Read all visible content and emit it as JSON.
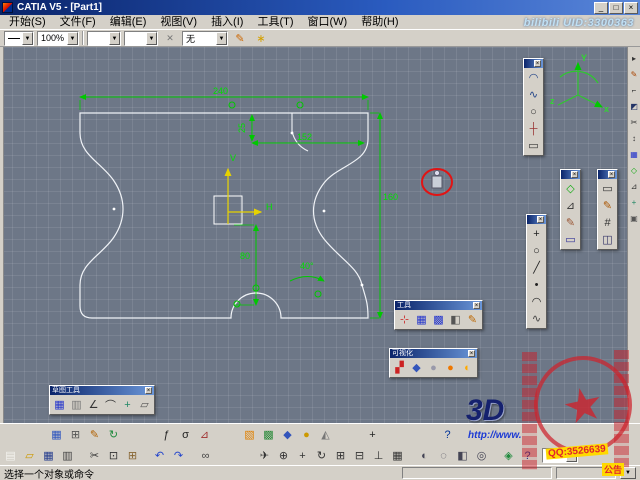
{
  "window": {
    "title": "CATIA V5 - [Part1]",
    "controls": [
      {
        "name": "minimize-button",
        "glyph": "_"
      },
      {
        "name": "maximize-button",
        "glyph": "□"
      },
      {
        "name": "close-button",
        "glyph": "×"
      }
    ]
  },
  "menu": {
    "items": [
      {
        "name": "menu-start",
        "label": "开始(S)"
      },
      {
        "name": "menu-file",
        "label": "文件(F)"
      },
      {
        "name": "menu-edit",
        "label": "编辑(E)"
      },
      {
        "name": "menu-view",
        "label": "视图(V)"
      },
      {
        "name": "menu-insert",
        "label": "插入(I)"
      },
      {
        "name": "menu-tools",
        "label": "工具(T)"
      },
      {
        "name": "menu-window",
        "label": "窗口(W)"
      },
      {
        "name": "menu-help",
        "label": "帮助(H)"
      }
    ]
  },
  "toolbar": {
    "zoom": "100%",
    "combo3": "",
    "combo4": "",
    "clear_glyph": "✕",
    "style_none": "无",
    "brush_glyph": "✎",
    "wand_glyph": "∗"
  },
  "viewport": {
    "dims": {
      "width": "240",
      "height": "160",
      "middle": "80",
      "step": "25",
      "upper": "152",
      "angle": "40°"
    },
    "labels": {
      "h": "H",
      "v": "V"
    },
    "compass": {
      "x": "x",
      "y": "Y",
      "z": "z"
    }
  },
  "palettes": {
    "a": {
      "icons": [
        {
          "name": "arc-icon",
          "glyph": "◠",
          "color": "#224488"
        },
        {
          "name": "spline-icon",
          "glyph": "∿",
          "color": "#224488"
        },
        {
          "name": "circle-tool-icon",
          "glyph": "○",
          "color": "#333333"
        },
        {
          "name": "axis-icon",
          "glyph": "┼",
          "color": "#993333"
        },
        {
          "name": "rect-tool-icon",
          "glyph": "▭",
          "color": "#333333"
        }
      ]
    },
    "b": {
      "icons": [
        {
          "name": "constraint-icon",
          "glyph": "◇",
          "color": "#11aa11"
        },
        {
          "name": "measure-icon",
          "glyph": "⊿",
          "color": "#333333"
        },
        {
          "name": "sketch-edit-icon",
          "glyph": "✎",
          "color": "#995533"
        },
        {
          "name": "frame-icon",
          "glyph": "▭",
          "color": "#333399"
        }
      ]
    },
    "c": {
      "icons": [
        {
          "name": "move-icon",
          "glyph": "+",
          "color": "#222222"
        },
        {
          "name": "circle-icon",
          "glyph": "○",
          "color": "#222222"
        },
        {
          "name": "line-icon",
          "glyph": "╱",
          "color": "#222222"
        },
        {
          "name": "point-icon",
          "glyph": "•",
          "color": "#222222"
        },
        {
          "name": "arc2-icon",
          "glyph": "◠",
          "color": "#222222"
        },
        {
          "name": "curve-icon",
          "glyph": "∿",
          "color": "#444444"
        }
      ]
    },
    "d": {
      "icons": [
        {
          "name": "plane-icon",
          "glyph": "▭",
          "color": "#333333"
        },
        {
          "name": "pencil-icon",
          "glyph": "✎",
          "color": "#aa5500"
        },
        {
          "name": "hatch-icon",
          "glyph": "#",
          "color": "#333333"
        },
        {
          "name": "view-icon",
          "glyph": "◫",
          "color": "#333366"
        }
      ]
    },
    "tools": {
      "title": "工具",
      "icons": [
        {
          "name": "axis-system-icon",
          "glyph": "⊹",
          "color": "#cc3333"
        },
        {
          "name": "grid-icon",
          "glyph": "▦",
          "color": "#2233cc"
        },
        {
          "name": "grid-dots-icon",
          "glyph": "▩",
          "color": "#2233cc"
        },
        {
          "name": "shade-half-icon",
          "glyph": "◧",
          "color": "#555555"
        },
        {
          "name": "edit-icon",
          "glyph": "✎",
          "color": "#bb6600"
        }
      ]
    },
    "viz": {
      "title": "可视化",
      "icons": [
        {
          "name": "paint-icon",
          "glyph": "▞",
          "color": "#cc2222"
        },
        {
          "name": "cube-icon",
          "glyph": "◆",
          "color": "#3355bb"
        },
        {
          "name": "gray-sphere-icon",
          "glyph": "●",
          "color": "#9999aa"
        },
        {
          "name": "orange-sphere-icon",
          "glyph": "●",
          "color": "#ee7700"
        },
        {
          "name": "halfshade-icon",
          "glyph": "◐",
          "color": "#ffaa00"
        }
      ]
    },
    "sketch": {
      "title": "草图工具",
      "icons": [
        {
          "name": "snap-grid-icon",
          "glyph": "▦",
          "color": "#2233cc"
        },
        {
          "name": "snap-point-icon",
          "glyph": "▥",
          "color": "#777777"
        },
        {
          "name": "angle-icon",
          "glyph": "∠",
          "color": "#333333"
        },
        {
          "name": "tangent-arc-icon",
          "glyph": "⌒",
          "color": "#333333"
        },
        {
          "name": "construction-icon",
          "glyph": "+",
          "color": "#228866"
        },
        {
          "name": "profile-icon",
          "glyph": "▱",
          "color": "#555555"
        }
      ]
    }
  },
  "rightbar": {
    "icons": [
      {
        "name": "select-icon",
        "glyph": "▸",
        "color": "#333333"
      },
      {
        "name": "pen-icon",
        "glyph": "✎",
        "color": "#aa4400"
      },
      {
        "name": "corner-icon",
        "glyph": "⌐",
        "color": "#333333"
      },
      {
        "name": "shade-icon",
        "glyph": "◩",
        "color": "#223366"
      },
      {
        "name": "trim-icon",
        "glyph": "✂",
        "color": "#333333"
      },
      {
        "name": "stretch-icon",
        "glyph": "↕",
        "color": "#333333"
      },
      {
        "name": "grid2-icon",
        "glyph": "▦",
        "color": "#2233cc"
      },
      {
        "name": "constraint2-icon",
        "glyph": "◇",
        "color": "#11aa11"
      },
      {
        "name": "triangle-icon",
        "glyph": "⊿",
        "color": "#333333"
      },
      {
        "name": "add-icon",
        "glyph": "+",
        "color": "#228866"
      },
      {
        "name": "box-icon",
        "glyph": "▣",
        "color": "#555555"
      }
    ]
  },
  "dock": {
    "row1": [
      {
        "name": "dock-grid-icon",
        "glyph": "▦",
        "color": "#2a52be",
        "ml": 46
      },
      {
        "name": "dock-table-icon",
        "glyph": "⊞",
        "color": "#555555"
      },
      {
        "name": "dock-pencil-icon",
        "glyph": "✎",
        "color": "#b06000"
      },
      {
        "name": "dock-update-icon",
        "glyph": "↻",
        "color": "#1f8a3d"
      },
      {
        "name": "dock-fx-icon",
        "glyph": "ƒ",
        "color": "#222222",
        "ml": 34
      },
      {
        "name": "dock-sigma-icon",
        "glyph": "σ",
        "color": "#222222"
      },
      {
        "name": "dock-measure-icon",
        "glyph": "⊿",
        "color": "#a03030"
      },
      {
        "name": "dock-orange-box-icon",
        "glyph": "▧",
        "color": "#e08000",
        "ml": 26
      },
      {
        "name": "dock-green-box-icon",
        "glyph": "▩",
        "color": "#2a8a3a"
      },
      {
        "name": "dock-diamond-icon",
        "glyph": "◆",
        "color": "#3355bb"
      },
      {
        "name": "dock-sphere-icon",
        "glyph": "●",
        "color": "#cc9900"
      },
      {
        "name": "dock-prism-icon",
        "glyph": "◭",
        "color": "#777777"
      },
      {
        "name": "dock-plus-icon",
        "glyph": "+",
        "color": "#222222",
        "ml": 28
      },
      {
        "name": "dock-help-icon",
        "glyph": "?",
        "color": "#003399",
        "ml": 56
      }
    ],
    "row2": [
      {
        "name": "new-icon",
        "glyph": "▤",
        "color": "#f5f5f0"
      },
      {
        "name": "open-icon",
        "glyph": "▱",
        "color": "#cc9900"
      },
      {
        "name": "save-icon",
        "glyph": "▦",
        "color": "#223a8c"
      },
      {
        "name": "print-icon",
        "glyph": "▥",
        "color": "#444444"
      },
      {
        "name": "cut-icon",
        "glyph": "✂",
        "color": "#333333",
        "ml": 8
      },
      {
        "name": "copy-icon",
        "glyph": "⊡",
        "color": "#333333"
      },
      {
        "name": "paste-icon",
        "glyph": "⊞",
        "color": "#886633"
      },
      {
        "name": "undo-icon",
        "glyph": "↶",
        "color": "#2244cc",
        "ml": 8
      },
      {
        "name": "redo-icon",
        "glyph": "↷",
        "color": "#2244cc"
      },
      {
        "name": "link-icon",
        "glyph": "∞",
        "color": "#444444",
        "ml": 8
      },
      {
        "name": "fly-icon",
        "glyph": "✈",
        "color": "#333333",
        "ml": 40
      },
      {
        "name": "fit-all-icon",
        "glyph": "⊕",
        "color": "#333333"
      },
      {
        "name": "pan-icon",
        "glyph": "+",
        "color": "#333333"
      },
      {
        "name": "rotate-icon",
        "glyph": "↻",
        "color": "#333333"
      },
      {
        "name": "zoom-in-icon",
        "glyph": "⊞",
        "color": "#333333"
      },
      {
        "name": "zoom-out-icon",
        "glyph": "⊟",
        "color": "#333333"
      },
      {
        "name": "normal-view-icon",
        "glyph": "⊥",
        "color": "#333333"
      },
      {
        "name": "multi-view-icon",
        "glyph": "▦",
        "color": "#333333"
      },
      {
        "name": "shaded-icon",
        "glyph": "◐",
        "color": "#444455",
        "ml": 8
      },
      {
        "name": "wireframe-icon",
        "glyph": "◌",
        "color": "#444455"
      },
      {
        "name": "material-icon",
        "glyph": "◧",
        "color": "#444455"
      },
      {
        "name": "hide-show-icon",
        "glyph": "◎",
        "color": "#444455"
      },
      {
        "name": "catalog-icon",
        "glyph": "◈",
        "color": "#1f8a3d",
        "ml": 8
      },
      {
        "name": "help-icon",
        "glyph": "?",
        "color": "#003399"
      }
    ]
  },
  "status": {
    "message": "选择一个对象或命令"
  },
  "watermarks": {
    "uid": "bilibili UID:3300363",
    "star": "★",
    "logo": "3D",
    "url": "http://www.",
    "qq": "QQ:3526639",
    "notice": "公告"
  }
}
